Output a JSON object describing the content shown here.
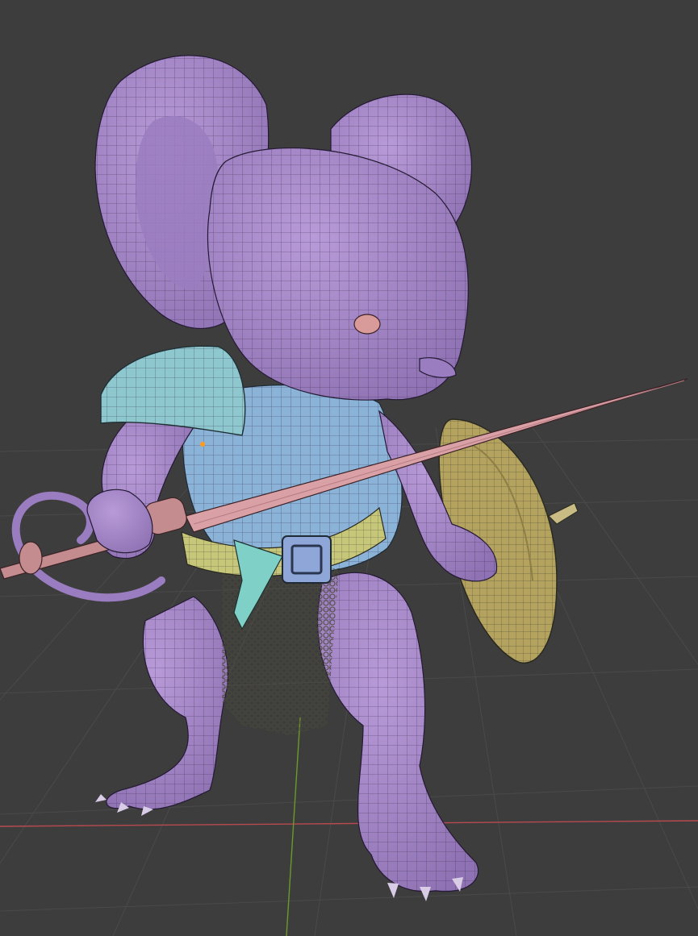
{
  "viewport": {
    "background": "#3d3d3d",
    "grid_color": "#4a4a4a",
    "x_axis_color": "#b84a4f",
    "y_axis_color": "#6b9a2a",
    "origin_color": "#ff9a1f"
  },
  "scene": {
    "subject": "mouse-warrior-character",
    "parts": [
      {
        "name": "body",
        "color": "#a587c8"
      },
      {
        "name": "shoulder-armor",
        "color": "#8fc7cf"
      },
      {
        "name": "chest-armor",
        "color": "#8bb3d8"
      },
      {
        "name": "belt",
        "color": "#c7c77a"
      },
      {
        "name": "belt-buckle",
        "color": "#8fa7d8"
      },
      {
        "name": "sash",
        "color": "#7fd0c7"
      },
      {
        "name": "chainmail",
        "color": "#3a3a34"
      },
      {
        "name": "sword",
        "color": "#d9a0a6"
      },
      {
        "name": "shield",
        "color": "#b4a35e"
      },
      {
        "name": "eye",
        "color": "#d99a9a"
      }
    ]
  }
}
